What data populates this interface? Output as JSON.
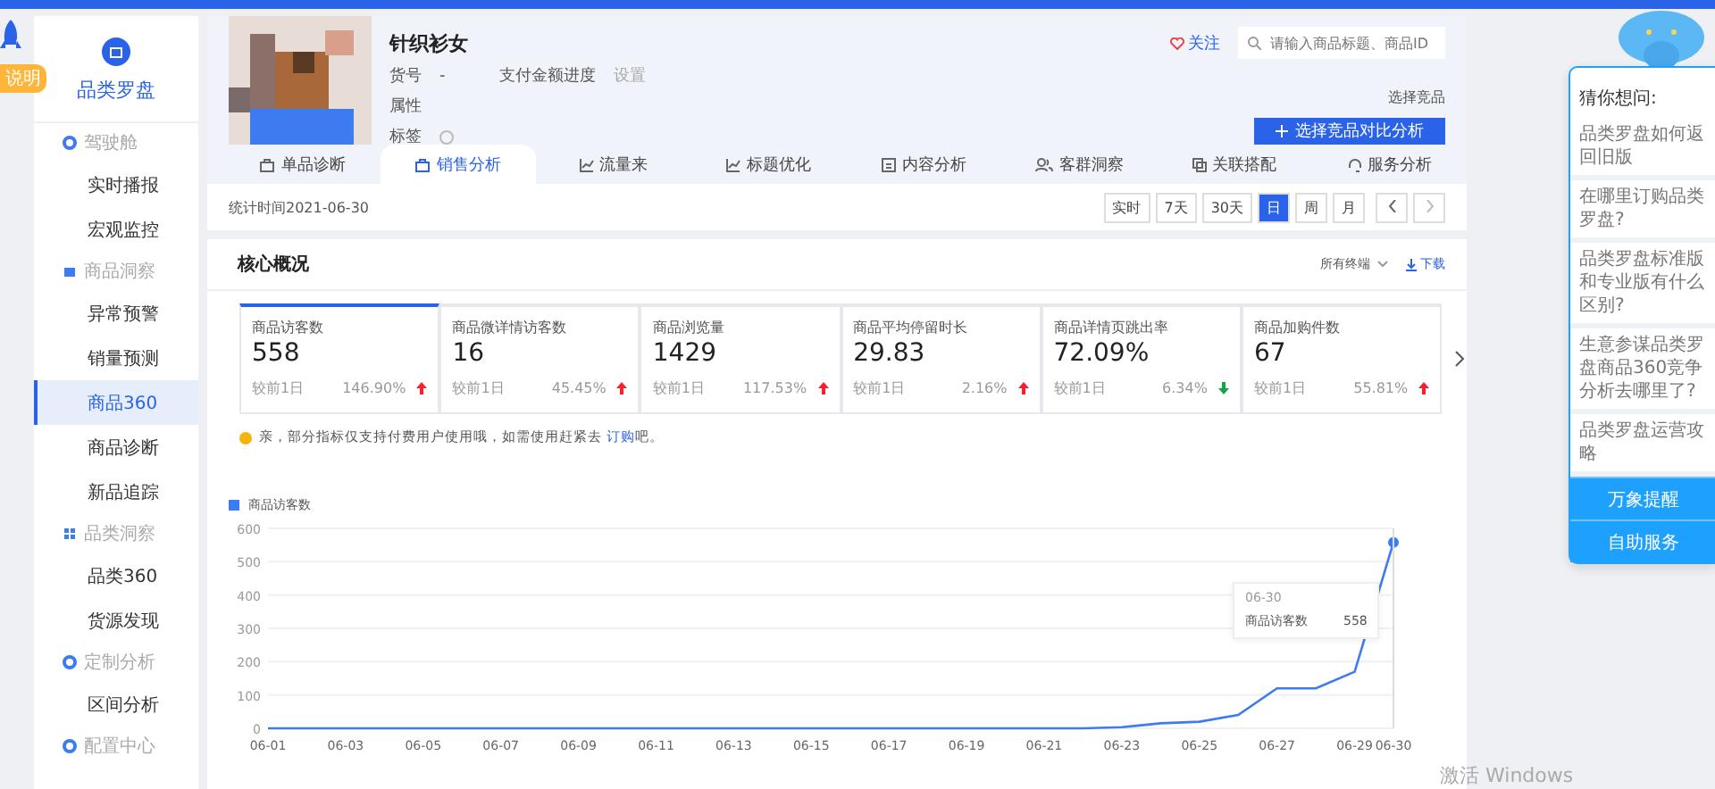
{
  "side_strip": {
    "badge": "说明"
  },
  "sidebar": {
    "logo_text": "品类罗盘",
    "sections": [
      {
        "title": "驾驶舱",
        "children": [
          {
            "label": "实时播报",
            "selected": false
          },
          {
            "label": "宏观监控",
            "selected": false
          }
        ]
      },
      {
        "title": "商品洞察",
        "children": [
          {
            "label": "异常预警",
            "selected": false
          },
          {
            "label": "销量预测",
            "selected": false
          },
          {
            "label": "商品360",
            "selected": true
          },
          {
            "label": "商品诊断",
            "selected": false
          },
          {
            "label": "新品追踪",
            "selected": false
          }
        ]
      },
      {
        "title": "品类洞察",
        "children": [
          {
            "label": "品类360",
            "selected": false
          },
          {
            "label": "货源发现",
            "selected": false
          }
        ]
      },
      {
        "title": "定制分析",
        "children": [
          {
            "label": "区间分析",
            "selected": false
          }
        ]
      },
      {
        "title": "配置中心"
      }
    ]
  },
  "product": {
    "kind": "picture",
    "title": "针织衫女",
    "sku_label": "货号",
    "sku_value": "-",
    "progress_label": "支付金额进度",
    "progress_action": "设置",
    "attr_label": "属性",
    "tag_label": "标签",
    "follow": "关注",
    "search": {
      "placeholder": "请输入商品标题、商品ID"
    },
    "compare_label": "选择竞品",
    "compare_button": "选择竞品对比分析"
  },
  "tabs": [
    {
      "label": "单品诊断",
      "selected": false
    },
    {
      "label": "销售分析",
      "selected": true
    },
    {
      "label": "流量来",
      "selected": false
    },
    {
      "label": "标题优化",
      "selected": false
    },
    {
      "label": "内容分析",
      "selected": false
    },
    {
      "label": "客群洞察",
      "selected": false
    },
    {
      "label": "关联搭配",
      "selected": false
    },
    {
      "label": "服务分析",
      "selected": false
    }
  ],
  "stat_time": "统计时间2021-06-30",
  "periods": [
    {
      "label": "实时",
      "selected": false
    },
    {
      "label": "7天",
      "selected": false
    },
    {
      "label": "30天",
      "selected": false
    },
    {
      "label": "日",
      "selected": true
    },
    {
      "label": "周",
      "selected": false
    },
    {
      "label": "月",
      "selected": false
    }
  ],
  "core": {
    "title": "核心概况",
    "terminal": "所有终端",
    "download": "下载",
    "metrics": [
      {
        "label": "商品访客数",
        "value": "558",
        "compare": "较前1日",
        "change": "146.90%",
        "rising": true,
        "selected": true
      },
      {
        "label": "商品微详情访客数",
        "value": "16",
        "compare": "较前1日",
        "change": "45.45%",
        "rising": true,
        "selected": false
      },
      {
        "label": "商品浏览量",
        "value": "1429",
        "compare": "较前1日",
        "change": "117.53%",
        "rising": true,
        "selected": false
      },
      {
        "label": "商品平均停留时长",
        "value": "29.83",
        "compare": "较前1日",
        "change": "2.16%",
        "rising": true,
        "selected": false
      },
      {
        "label": "商品详情页跳出率",
        "value": "72.09%",
        "compare": "较前1日",
        "change": "6.34%",
        "rising": false,
        "selected": false
      },
      {
        "label": "商品加购件数",
        "value": "67",
        "compare": "较前1日",
        "change": "55.81%",
        "rising": true,
        "selected": false
      }
    ],
    "notice": "亲，部分指标仅支持付费用户使用哦，如需使用赶紧去 ",
    "notice_link": "订购",
    "notice_end": "吧。",
    "chart_data": {
      "type": "line",
      "categories": [
        "06-01",
        null,
        "06-03",
        null,
        "06-05",
        null,
        "06-07",
        null,
        "06-09",
        null,
        "06-11",
        null,
        "06-13",
        null,
        "06-15",
        null,
        "06-17",
        null,
        "06-19",
        null,
        "06-21",
        null,
        "06-23",
        null,
        "06-25",
        null,
        "06-27",
        null,
        "06-29",
        "06-30"
      ],
      "grid": true,
      "series": [
        {
          "name": "商品访客数",
          "color": "#3d7bf0",
          "values": [
            0,
            0,
            0,
            0,
            0,
            0,
            0,
            0,
            0,
            0,
            0,
            0,
            0,
            0,
            0,
            0,
            0,
            0,
            0,
            0,
            0,
            0,
            3,
            15,
            20,
            40,
            120,
            120,
            170,
            558
          ]
        }
      ],
      "ylim": [
        0,
        600
      ],
      "yticks": [
        0,
        100,
        200,
        300,
        400,
        500,
        600
      ]
    },
    "tooltip": {
      "date": "06-30",
      "name": "商品访客数",
      "value": "558"
    }
  },
  "assistant": {
    "title": "猜你想问:",
    "questions": [
      "品类罗盘如何返回旧版",
      "在哪里订购品类罗盘?",
      "品类罗盘标准版和专业版有什么区别?",
      "生意参谋品类罗盘商品360竞争分析去哪里了?",
      "品类罗盘运营攻略"
    ],
    "buttons": [
      "万象提醒",
      "自助服务"
    ]
  },
  "os_notice": "激活 Windows"
}
